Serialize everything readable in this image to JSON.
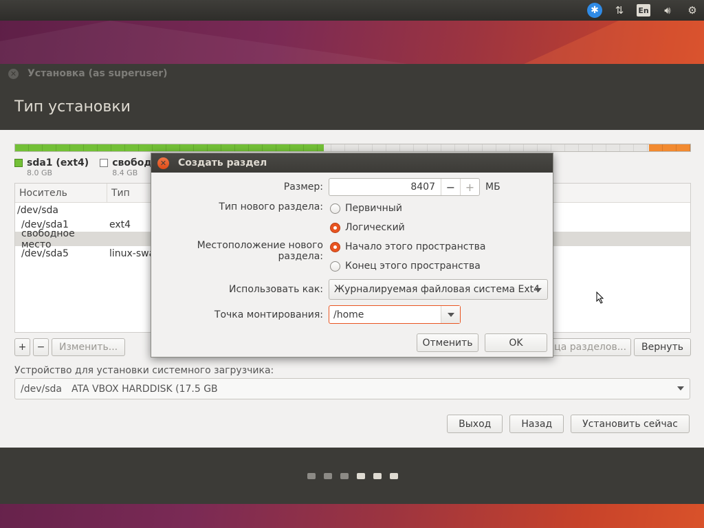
{
  "top_panel": {
    "icons": [
      "accessibility-icon",
      "network-transfer-icon",
      "keyboard-layout-icon",
      "volume-icon",
      "system-gear-icon"
    ],
    "keyboard_layout": "En"
  },
  "window": {
    "title": "Установка (as superuser)",
    "page_title": "Тип установки"
  },
  "partition_bar": {
    "segments": [
      {
        "name": "sda1",
        "fraction": 0.457,
        "color": "#73c037"
      },
      {
        "name": "free",
        "fraction": 0.482,
        "color": "#e6e5e3"
      },
      {
        "name": "sda5",
        "fraction": 0.061,
        "color": "#f28a30"
      }
    ]
  },
  "legend": [
    {
      "label": "sda1 (ext4)",
      "size": "8.0 GB",
      "color": "#73c037"
    },
    {
      "label": "свободно",
      "size": "8.4 GB",
      "color": "#ffffff"
    }
  ],
  "table": {
    "columns": [
      "Носитель",
      "Тип"
    ],
    "rows": [
      {
        "device": "/dev/sda",
        "type": ""
      },
      {
        "device": " /dev/sda1",
        "type": "ext4"
      },
      {
        "device": " свободное место",
        "type": ""
      },
      {
        "device": " /dev/sda5",
        "type": "linux-swa"
      }
    ],
    "selected_row": 2
  },
  "tools": {
    "add": "+",
    "remove": "−",
    "change": "Изменить...",
    "new_table": "блица разделов...",
    "revert": "Вернуть"
  },
  "bootloader": {
    "label": "Устройство для установки системного загрузчика:",
    "device": "/dev/sda",
    "description": "ATA VBOX HARDDISK (17.5 GB"
  },
  "nav": {
    "quit": "Выход",
    "back": "Назад",
    "install": "Установить сейчас"
  },
  "progress_dots": {
    "total": 6,
    "done": 4
  },
  "dialog": {
    "title": "Создать раздел",
    "size_label": "Размер:",
    "size_value": "8407",
    "size_unit": "МБ",
    "type_label": "Тип нового раздела:",
    "type_primary": "Первичный",
    "type_logical": "Логический",
    "location_label": "Местоположение нового раздела:",
    "location_start": "Начало этого пространства",
    "location_end": "Конец этого пространства",
    "use_as_label": "Использовать как:",
    "use_as_value": "Журналируемая файловая система Ext4",
    "mount_label": "Точка монтирования:",
    "mount_value": "/home",
    "cancel": "Отменить",
    "ok": "OK"
  }
}
